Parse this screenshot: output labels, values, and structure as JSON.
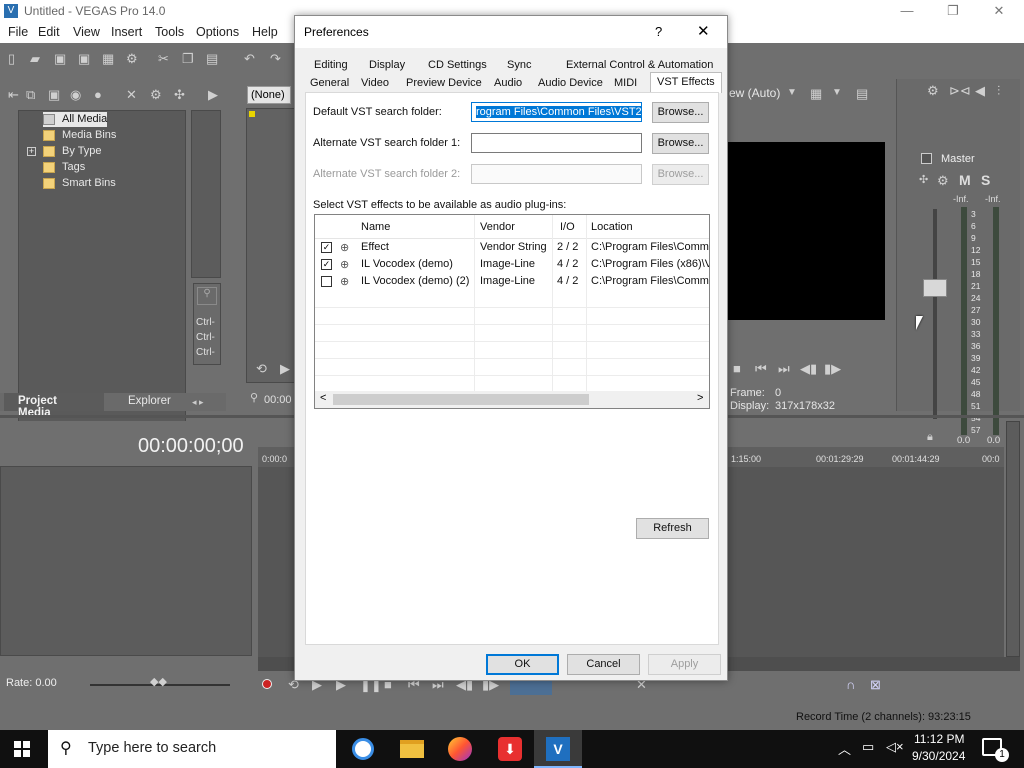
{
  "app": {
    "title": "Untitled - VEGAS Pro 14.0",
    "menu": [
      "File",
      "Edit",
      "View",
      "Insert",
      "Tools",
      "Options",
      "Help"
    ]
  },
  "project_media": {
    "tree": [
      "All Media",
      "Media Bins",
      "By Type",
      "Tags",
      "Smart Bins"
    ],
    "expand_glyph": "+",
    "tabs": [
      "Project Media",
      "Explorer"
    ],
    "ctrl_labels": [
      "Ctrl-",
      "Ctrl-",
      "Ctrl-"
    ]
  },
  "preview": {
    "none_label": "(None)",
    "time_short": "00:00",
    "preview_auto": "ew (Auto)",
    "frame_label": "Frame:",
    "frame_value": "0",
    "display_label": "Display:",
    "display_value": "317x178x32"
  },
  "master": {
    "label": "Master",
    "m": "M",
    "s": "S",
    "inf": [
      "-Inf.",
      "-Inf."
    ],
    "scale": [
      "3",
      "6",
      "9",
      "12",
      "15",
      "18",
      "21",
      "24",
      "27",
      "30",
      "33",
      "36",
      "39",
      "42",
      "45",
      "48",
      "51",
      "54",
      "57"
    ],
    "bottom_values": [
      "0.0",
      "0.0"
    ]
  },
  "timeline": {
    "timecode": "00:00:00;00",
    "ruler": [
      "0:00:0",
      "1:15:00",
      "00:01:29:29",
      "00:01:44:29",
      "00:0"
    ],
    "rate": "Rate: 0.00",
    "record_time": "Record Time (2 channels): 93:23:15"
  },
  "dialog": {
    "title": "Preferences",
    "help_glyph": "?",
    "close_glyph": "✕",
    "tabs_top": [
      "Editing",
      "Display",
      "CD Settings",
      "Sync",
      "External Control & Automation"
    ],
    "tabs_bottom": [
      "General",
      "Video",
      "Preview Device",
      "Audio",
      "Audio Device",
      "MIDI",
      "VST Effects"
    ],
    "default_label": "Default VST search folder:",
    "default_value": "rogram Files\\Common Files\\VST2\\",
    "alt1_label": "Alternate VST search folder 1:",
    "alt1_value": "",
    "alt2_label": "Alternate VST search folder 2:",
    "alt2_value": "",
    "browse": "Browse...",
    "select_label": "Select VST effects to be available as audio plug-ins:",
    "columns": [
      "Name",
      "Vendor",
      "I/O",
      "Location"
    ],
    "rows": [
      {
        "checked": true,
        "name": "Effect",
        "vendor": "Vendor String",
        "io": "2 / 2",
        "location": "C:\\Program Files\\Commo"
      },
      {
        "checked": true,
        "name": "IL Vocodex (demo)",
        "vendor": "Image-Line",
        "io": "4 / 2",
        "location": "C:\\Program Files (x86)\\V"
      },
      {
        "checked": false,
        "name": "IL Vocodex (demo) (2)",
        "vendor": "Image-Line",
        "io": "4 / 2",
        "location": "C:\\Program Files\\Commo"
      }
    ],
    "refresh": "Refresh",
    "ok": "OK",
    "cancel": "Cancel",
    "apply": "Apply",
    "check_glyph": "✓",
    "scroll_left": "<",
    "scroll_right": ">"
  },
  "taskbar": {
    "search_placeholder": "Type here to search",
    "time": "11:12 PM",
    "date": "9/30/2024",
    "notif_count": "1"
  },
  "colors": {
    "selection": "#0078d7",
    "folder": "#f3d27a",
    "app_bg": "#6f6f6f"
  }
}
